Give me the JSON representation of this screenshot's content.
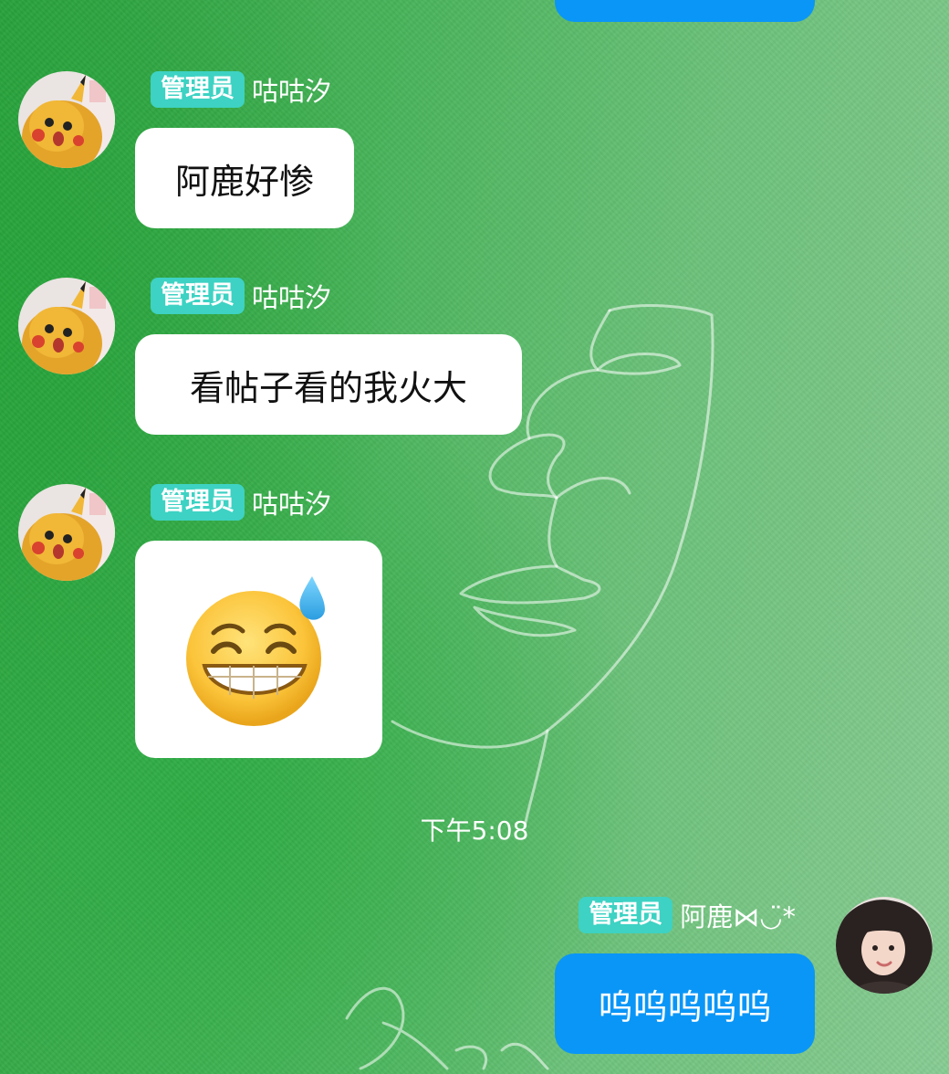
{
  "colors": {
    "badge": "#3dd2c3",
    "outgoing_bubble": "#0a96f7",
    "incoming_bubble": "#ffffff"
  },
  "messages": [
    {
      "sender_badge": "管理员",
      "sender_name": "咕咕汐",
      "text": "阿鹿好惨",
      "direction": "incoming"
    },
    {
      "sender_badge": "管理员",
      "sender_name": "咕咕汐",
      "text": "看帖子看的我火大",
      "direction": "incoming"
    },
    {
      "sender_badge": "管理员",
      "sender_name": "咕咕汐",
      "sticker": "grinning-sweat-emoji",
      "direction": "incoming"
    }
  ],
  "timestamp": "下午5:08",
  "outgoing": {
    "sender_badge": "管理员",
    "sender_name": "阿鹿⋈◡̈*",
    "text": "呜呜呜呜呜",
    "direction": "outgoing"
  }
}
